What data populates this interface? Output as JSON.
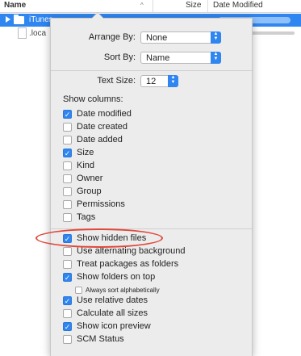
{
  "header": {
    "name_label": "Name",
    "sort_glyph": "^",
    "size_label": "Size",
    "date_label": "Date Modified"
  },
  "rows": [
    {
      "label": "iTunes",
      "icon": "folder-icon",
      "selected": true
    },
    {
      "label": ".loca",
      "icon": "document-icon",
      "selected": false
    }
  ],
  "panel": {
    "arrange_by_label": "Arrange By:",
    "arrange_by_value": "None",
    "sort_by_label": "Sort By:",
    "sort_by_value": "Name",
    "text_size_label": "Text Size:",
    "text_size_value": "12",
    "show_columns_label": "Show columns:",
    "columns": [
      {
        "label": "Date modified",
        "checked": true
      },
      {
        "label": "Date created",
        "checked": false
      },
      {
        "label": "Date added",
        "checked": false
      },
      {
        "label": "Size",
        "checked": true
      },
      {
        "label": "Kind",
        "checked": false
      },
      {
        "label": "Owner",
        "checked": false
      },
      {
        "label": "Group",
        "checked": false
      },
      {
        "label": "Permissions",
        "checked": false
      },
      {
        "label": "Tags",
        "checked": false
      }
    ],
    "options": [
      {
        "label": "Show hidden files",
        "checked": true
      },
      {
        "label": "Use alternating background",
        "checked": false
      },
      {
        "label": "Treat packages as folders",
        "checked": false
      },
      {
        "label": "Show folders on top",
        "checked": true
      },
      {
        "label": "Always sort alphabetically",
        "checked": false,
        "small": true
      },
      {
        "label": "Use relative dates",
        "checked": true
      },
      {
        "label": "Calculate all sizes",
        "checked": false
      },
      {
        "label": "Show icon preview",
        "checked": true
      },
      {
        "label": "SCM Status",
        "checked": false
      }
    ]
  },
  "colors": {
    "accent": "#2f86f0",
    "annotation": "#e0483a"
  }
}
